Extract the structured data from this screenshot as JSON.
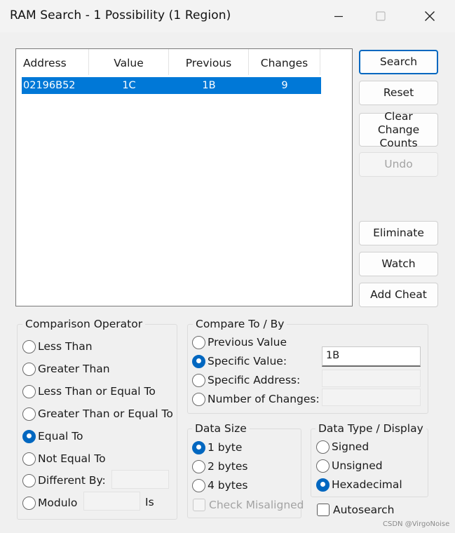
{
  "window": {
    "title": "RAM Search - 1 Possibility (1 Region)",
    "buttons": {
      "minimize": "minimize",
      "maximize": "maximize",
      "close": "close"
    }
  },
  "list": {
    "columns": [
      "Address",
      "Value",
      "Previous",
      "Changes"
    ],
    "rows": [
      {
        "address": "02196B52",
        "value": "1C",
        "previous": "1B",
        "changes": "9",
        "selected": true
      }
    ]
  },
  "buttons": {
    "search": "Search",
    "reset": "Reset",
    "clear_change_counts": "Clear Change Counts",
    "undo": "Undo",
    "eliminate": "Eliminate",
    "watch": "Watch",
    "add_cheat": "Add Cheat"
  },
  "comparison_operator": {
    "legend": "Comparison Operator",
    "options": [
      "Less Than",
      "Greater Than",
      "Less Than or Equal To",
      "Greater Than or Equal To",
      "Equal To",
      "Not Equal To",
      "Different By:",
      "Modulo"
    ],
    "selected": "Equal To",
    "different_by_value": "",
    "modulo_value": "",
    "modulo_suffix": "Is"
  },
  "compare_to": {
    "legend": "Compare To / By",
    "options": [
      "Previous Value",
      "Specific Value:",
      "Specific Address:",
      "Number of Changes:"
    ],
    "selected": "Specific Value:",
    "specific_value": "1B",
    "specific_address": "",
    "number_of_changes": ""
  },
  "data_size": {
    "legend": "Data Size",
    "options": [
      "1 byte",
      "2 bytes",
      "4 bytes"
    ],
    "selected": "1 byte",
    "check_misaligned": "Check Misaligned"
  },
  "data_type": {
    "legend": "Data Type / Display",
    "options": [
      "Signed",
      "Unsigned",
      "Hexadecimal"
    ],
    "selected": "Hexadecimal"
  },
  "autosearch": "Autosearch",
  "watermark": "CSDN @VirgoNoise",
  "colors": {
    "accent": "#0067c0",
    "selection": "#0078d7",
    "window_bg": "#f0f0f0"
  }
}
